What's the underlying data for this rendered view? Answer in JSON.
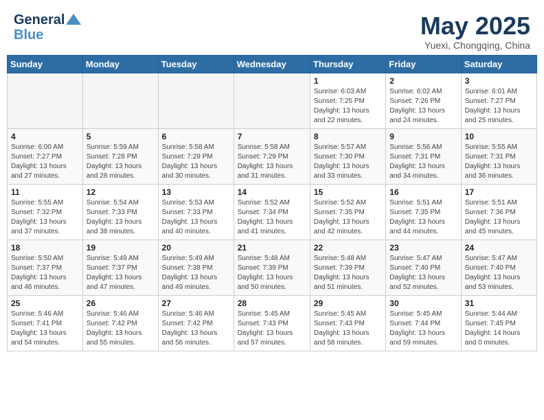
{
  "header": {
    "logo_line1": "General",
    "logo_line2": "Blue",
    "month_title": "May 2025",
    "location": "Yuexi, Chongqing, China"
  },
  "weekdays": [
    "Sunday",
    "Monday",
    "Tuesday",
    "Wednesday",
    "Thursday",
    "Friday",
    "Saturday"
  ],
  "weeks": [
    [
      {
        "day": "",
        "info": ""
      },
      {
        "day": "",
        "info": ""
      },
      {
        "day": "",
        "info": ""
      },
      {
        "day": "",
        "info": ""
      },
      {
        "day": "1",
        "info": "Sunrise: 6:03 AM\nSunset: 7:25 PM\nDaylight: 13 hours\nand 22 minutes."
      },
      {
        "day": "2",
        "info": "Sunrise: 6:02 AM\nSunset: 7:26 PM\nDaylight: 13 hours\nand 24 minutes."
      },
      {
        "day": "3",
        "info": "Sunrise: 6:01 AM\nSunset: 7:27 PM\nDaylight: 13 hours\nand 25 minutes."
      }
    ],
    [
      {
        "day": "4",
        "info": "Sunrise: 6:00 AM\nSunset: 7:27 PM\nDaylight: 13 hours\nand 27 minutes."
      },
      {
        "day": "5",
        "info": "Sunrise: 5:59 AM\nSunset: 7:28 PM\nDaylight: 13 hours\nand 28 minutes."
      },
      {
        "day": "6",
        "info": "Sunrise: 5:58 AM\nSunset: 7:29 PM\nDaylight: 13 hours\nand 30 minutes."
      },
      {
        "day": "7",
        "info": "Sunrise: 5:58 AM\nSunset: 7:29 PM\nDaylight: 13 hours\nand 31 minutes."
      },
      {
        "day": "8",
        "info": "Sunrise: 5:57 AM\nSunset: 7:30 PM\nDaylight: 13 hours\nand 33 minutes."
      },
      {
        "day": "9",
        "info": "Sunrise: 5:56 AM\nSunset: 7:31 PM\nDaylight: 13 hours\nand 34 minutes."
      },
      {
        "day": "10",
        "info": "Sunrise: 5:55 AM\nSunset: 7:31 PM\nDaylight: 13 hours\nand 36 minutes."
      }
    ],
    [
      {
        "day": "11",
        "info": "Sunrise: 5:55 AM\nSunset: 7:32 PM\nDaylight: 13 hours\nand 37 minutes."
      },
      {
        "day": "12",
        "info": "Sunrise: 5:54 AM\nSunset: 7:33 PM\nDaylight: 13 hours\nand 38 minutes."
      },
      {
        "day": "13",
        "info": "Sunrise: 5:53 AM\nSunset: 7:33 PM\nDaylight: 13 hours\nand 40 minutes."
      },
      {
        "day": "14",
        "info": "Sunrise: 5:52 AM\nSunset: 7:34 PM\nDaylight: 13 hours\nand 41 minutes."
      },
      {
        "day": "15",
        "info": "Sunrise: 5:52 AM\nSunset: 7:35 PM\nDaylight: 13 hours\nand 42 minutes."
      },
      {
        "day": "16",
        "info": "Sunrise: 5:51 AM\nSunset: 7:35 PM\nDaylight: 13 hours\nand 44 minutes."
      },
      {
        "day": "17",
        "info": "Sunrise: 5:51 AM\nSunset: 7:36 PM\nDaylight: 13 hours\nand 45 minutes."
      }
    ],
    [
      {
        "day": "18",
        "info": "Sunrise: 5:50 AM\nSunset: 7:37 PM\nDaylight: 13 hours\nand 46 minutes."
      },
      {
        "day": "19",
        "info": "Sunrise: 5:49 AM\nSunset: 7:37 PM\nDaylight: 13 hours\nand 47 minutes."
      },
      {
        "day": "20",
        "info": "Sunrise: 5:49 AM\nSunset: 7:38 PM\nDaylight: 13 hours\nand 49 minutes."
      },
      {
        "day": "21",
        "info": "Sunrise: 5:48 AM\nSunset: 7:39 PM\nDaylight: 13 hours\nand 50 minutes."
      },
      {
        "day": "22",
        "info": "Sunrise: 5:48 AM\nSunset: 7:39 PM\nDaylight: 13 hours\nand 51 minutes."
      },
      {
        "day": "23",
        "info": "Sunrise: 5:47 AM\nSunset: 7:40 PM\nDaylight: 13 hours\nand 52 minutes."
      },
      {
        "day": "24",
        "info": "Sunrise: 5:47 AM\nSunset: 7:40 PM\nDaylight: 13 hours\nand 53 minutes."
      }
    ],
    [
      {
        "day": "25",
        "info": "Sunrise: 5:46 AM\nSunset: 7:41 PM\nDaylight: 13 hours\nand 54 minutes."
      },
      {
        "day": "26",
        "info": "Sunrise: 5:46 AM\nSunset: 7:42 PM\nDaylight: 13 hours\nand 55 minutes."
      },
      {
        "day": "27",
        "info": "Sunrise: 5:46 AM\nSunset: 7:42 PM\nDaylight: 13 hours\nand 56 minutes."
      },
      {
        "day": "28",
        "info": "Sunrise: 5:45 AM\nSunset: 7:43 PM\nDaylight: 13 hours\nand 57 minutes."
      },
      {
        "day": "29",
        "info": "Sunrise: 5:45 AM\nSunset: 7:43 PM\nDaylight: 13 hours\nand 58 minutes."
      },
      {
        "day": "30",
        "info": "Sunrise: 5:45 AM\nSunset: 7:44 PM\nDaylight: 13 hours\nand 59 minutes."
      },
      {
        "day": "31",
        "info": "Sunrise: 5:44 AM\nSunset: 7:45 PM\nDaylight: 14 hours\nand 0 minutes."
      }
    ]
  ]
}
